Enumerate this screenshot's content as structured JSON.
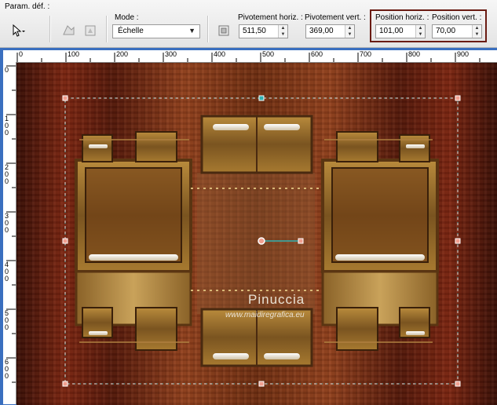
{
  "toolbar": {
    "presets_label": "Param. déf. :",
    "mode_label": "Mode :",
    "mode_value": "Échelle",
    "pivot_h_label": "Pivotement horiz. :",
    "pivot_h_value": "511,50",
    "pivot_v_label": "Pivotement vert. :",
    "pivot_v_value": "369,00",
    "pos_h_label": "Position horiz. :",
    "pos_h_value": "101,00",
    "pos_v_label": "Position vert. :",
    "pos_v_value": "70,00",
    "highlight_color": "#6a1b12"
  },
  "ruler": {
    "h_ticks": [
      "0",
      "100",
      "200",
      "300",
      "400",
      "500",
      "600",
      "700",
      "800",
      "900"
    ],
    "v_ticks": [
      "0",
      "100",
      "200",
      "300",
      "400",
      "500",
      "600"
    ]
  },
  "watermark": {
    "name": "Pinuccia",
    "url": "www.maidiregrafica.eu"
  },
  "icons": [
    "pointer-arrow-icon",
    "flip-horizontal-icon",
    "flip-vertical-icon",
    "pivot-icon"
  ]
}
